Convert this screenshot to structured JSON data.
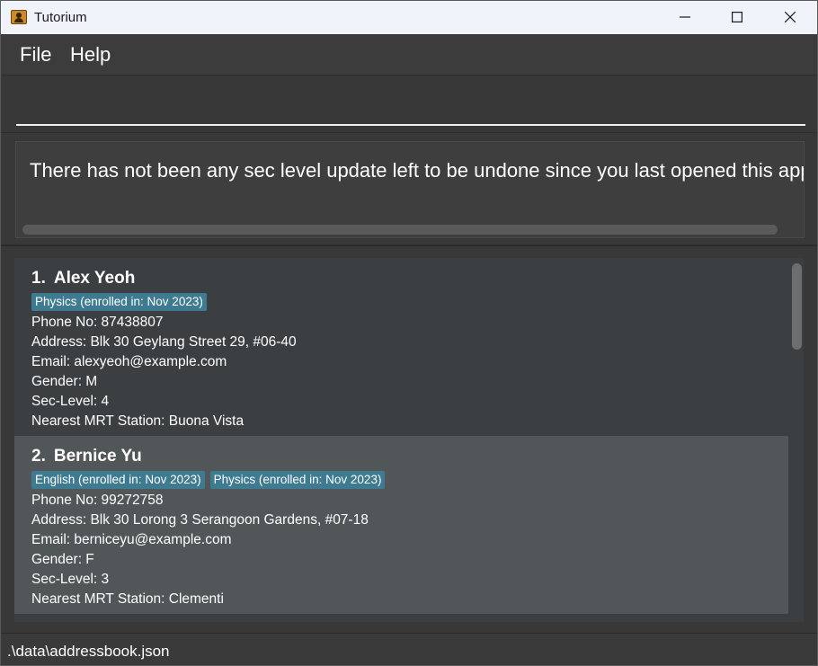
{
  "window": {
    "title": "Tutorium",
    "icon": "app-contact-icon"
  },
  "menubar": {
    "file_label": "File",
    "help_label": "Help"
  },
  "command": {
    "value": "",
    "placeholder": ""
  },
  "result": {
    "message": "There has not been any sec level update left to be undone since you last opened this application"
  },
  "persons": [
    {
      "index": "1.",
      "name": "Alex Yeoh",
      "tags": [
        "Physics (enrolled in: Nov 2023)"
      ],
      "phone": "Phone No: 87438807",
      "address": "Address: Blk 30 Geylang Street 29, #06-40",
      "email": "Email: alexyeoh@example.com",
      "gender": "Gender: M",
      "sec_level": "Sec-Level: 4",
      "mrt": "Nearest MRT Station: Buona Vista"
    },
    {
      "index": "2.",
      "name": "Bernice Yu",
      "tags": [
        "English (enrolled in: Nov 2023)",
        "Physics (enrolled in: Nov 2023)"
      ],
      "phone": "Phone No: 99272758",
      "address": "Address: Blk 30 Lorong 3 Serangoon Gardens, #07-18",
      "email": "Email: berniceyu@example.com",
      "gender": "Gender: F",
      "sec_level": "Sec-Level: 3",
      "mrt": "Nearest MRT Station: Clementi"
    }
  ],
  "status": {
    "file_path": ".\\data\\addressbook.json"
  },
  "colors": {
    "tag": "#3e7b91",
    "card_odd": "#3c3f41",
    "card_even": "#515658"
  }
}
